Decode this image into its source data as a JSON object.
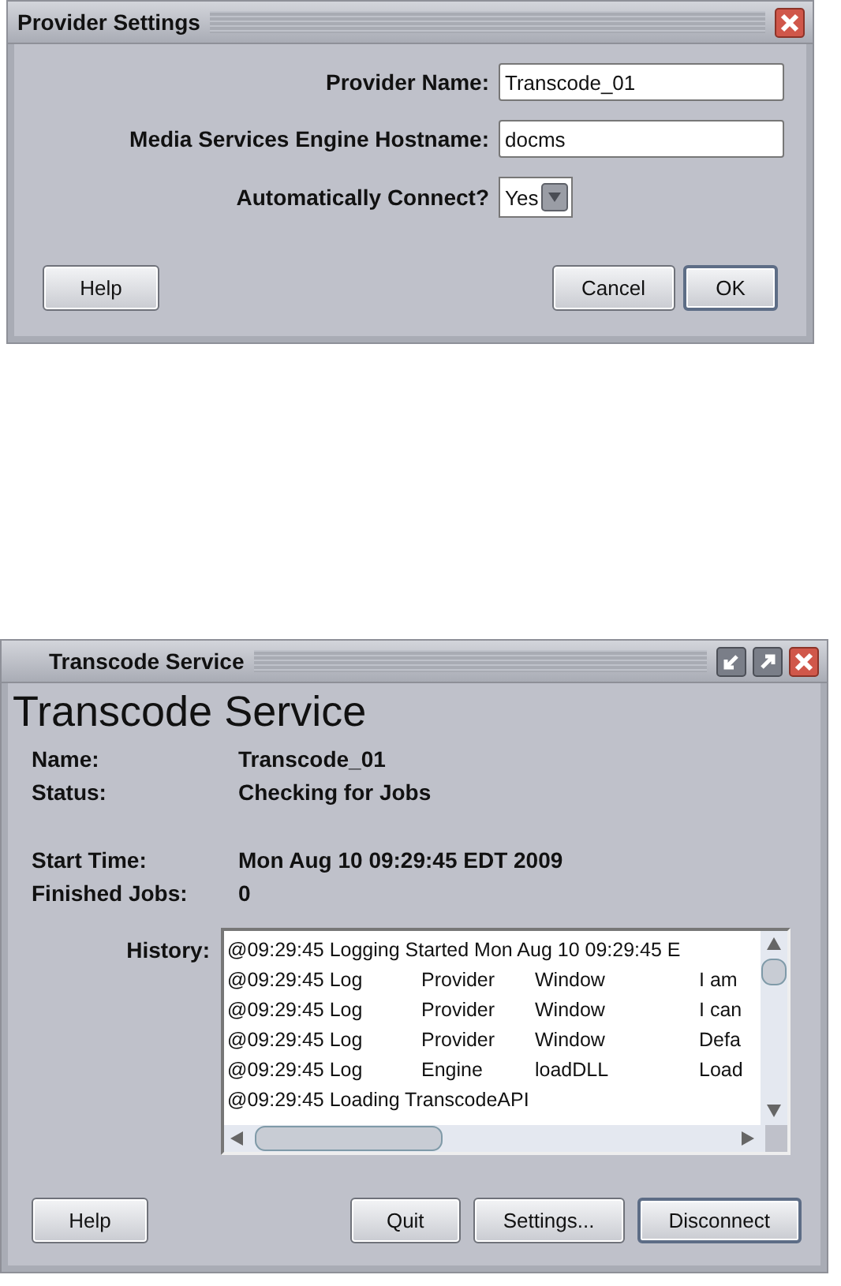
{
  "provider_settings": {
    "title": "Provider Settings",
    "title_buttons": [
      {
        "kind": "close"
      }
    ],
    "fields": [
      {
        "kind": "text",
        "label": "Provider Name:",
        "value": "Transcode_01"
      },
      {
        "kind": "text",
        "label": "Media Services Engine Hostname:",
        "value": "docms"
      },
      {
        "kind": "dropdown",
        "label": "Automatically Connect?",
        "value": "Yes"
      }
    ],
    "buttons_left": [
      "Help"
    ],
    "buttons_right": [
      {
        "label": "Cancel",
        "default": false
      },
      {
        "label": "OK",
        "default": true
      }
    ]
  },
  "transcode_service": {
    "title": "Transcode Service",
    "title_buttons": [
      {
        "kind": "restore"
      },
      {
        "kind": "maximize"
      },
      {
        "kind": "close"
      }
    ],
    "heading": "Transcode Service",
    "info_groups": [
      [
        {
          "label": "Name:",
          "value": "Transcode_01"
        },
        {
          "label": "Status:",
          "value": "Checking for Jobs"
        }
      ],
      [
        {
          "label": "Start Time:",
          "value": "Mon Aug 10 09:29:45 EDT 2009"
        },
        {
          "label": "Finished Jobs:",
          "value": "0"
        }
      ]
    ],
    "history_label": "History:",
    "history": [
      [
        "@09:29:45 Logging Started Mon Aug 10 09:29:45 E"
      ],
      [
        "@09:29:45 Log",
        "Provider",
        "Window",
        "I am"
      ],
      [
        "@09:29:45 Log",
        "Provider",
        "Window",
        "I can"
      ],
      [
        "@09:29:45 Log",
        "Provider",
        "Window",
        "Defa"
      ],
      [
        "@09:29:45 Log",
        "Engine",
        "loadDLL",
        "Load"
      ],
      [
        "@09:29:45 Loading TranscodeAPI"
      ]
    ],
    "buttons_left": [
      "Help"
    ],
    "buttons_right": [
      {
        "label": "Quit",
        "default": false
      },
      {
        "label": "Settings...",
        "default": false
      },
      {
        "label": "Disconnect",
        "default": true
      }
    ]
  }
}
